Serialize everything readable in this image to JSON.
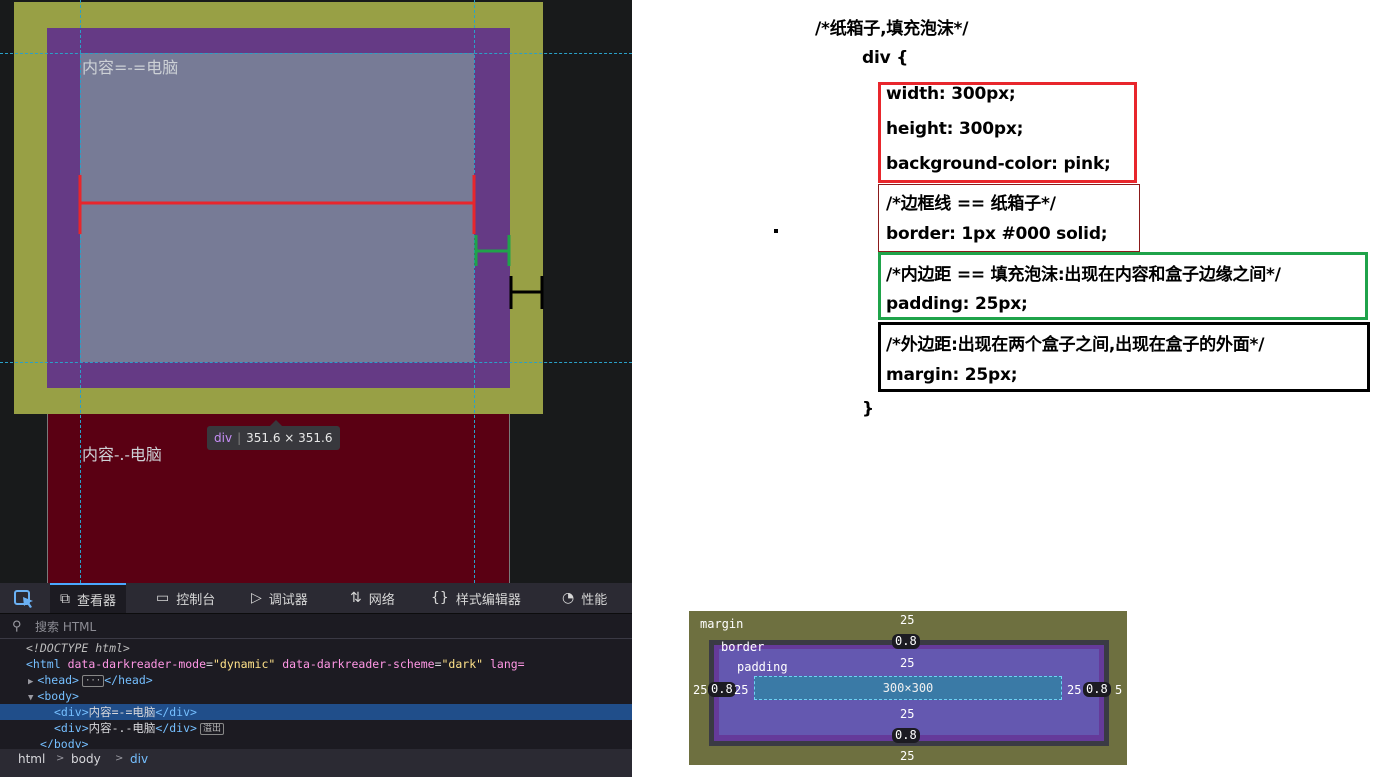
{
  "page": {
    "box_text_1": "内容=-=电脑",
    "box_text_2": "内容-.-电脑"
  },
  "tooltip": {
    "tag": "div",
    "size": "351.6 × 351.6"
  },
  "devtools": {
    "tabs": [
      {
        "label": "查看器",
        "icon": "inspector-icon",
        "active": true
      },
      {
        "label": "控制台",
        "icon": "console-icon",
        "active": false
      },
      {
        "label": "调试器",
        "icon": "debugger-icon",
        "active": false
      },
      {
        "label": "网络",
        "icon": "network-icon",
        "active": false
      },
      {
        "label": "样式编辑器",
        "icon": "style-editor-icon",
        "active": false
      },
      {
        "label": "性能",
        "icon": "performance-icon",
        "active": false
      }
    ],
    "search_placeholder": "搜索 HTML",
    "markup": {
      "doctype": "<!DOCTYPE html>",
      "html_open": "<html",
      "attr1_name": "data-darkreader-mode",
      "attr1_value": "\"dynamic\"",
      "attr2_name": "data-darkreader-scheme",
      "attr2_value": "\"dark\"",
      "attr3_name": "lang=",
      "head_open": "<head>",
      "head_badge": "···",
      "head_close": "</head>",
      "body_open": "<body>",
      "div1_open": "<div>",
      "div1_text": "内容=-=电脑",
      "div1_close": "</div>",
      "div2_open": "<div>",
      "div2_text": "内容-.-电脑",
      "div2_close": "</div>",
      "div2_badge": "溢出",
      "body_close": "</body>"
    },
    "breadcrumbs": [
      "html",
      "body",
      "div"
    ]
  },
  "code": {
    "comment_title": "/*纸箱子,填充泡沫*/",
    "selector": "div {",
    "width": "width: 300px;",
    "height": "height: 300px;",
    "background": "background-color: pink;",
    "border_comment": "/*边框线 == 纸箱子*/",
    "border": "border: 1px #000 solid;",
    "padding_comment": "/*内边距 == 填充泡沫:出现在内容和盒子边缘之间*/",
    "padding": "padding: 25px;",
    "margin_comment": "/*外边距:出现在两个盒子之间,出现在盒子的外面*/",
    "margin": "margin: 25px;",
    "close": "}"
  },
  "box_model": {
    "margin_label": "margin",
    "border_label": "border",
    "padding_label": "padding",
    "content_size": "300×300",
    "margin_top": "25",
    "margin_bottom": "25",
    "margin_left": "25",
    "margin_right": "5",
    "border_top": "0.8",
    "border_bottom": "0.8",
    "border_left": "0.8",
    "border_right": "0.8",
    "padding_top": "25",
    "padding_bottom": "25",
    "padding_left": "25",
    "padding_right": "25"
  },
  "colors": {
    "margin_highlight": "#98a045",
    "border_highlight": "#653a85",
    "content_highlight": "#777b96",
    "annotation_red": "#e8262c",
    "annotation_green": "#1fa34a",
    "annotation_black": "#000000"
  }
}
